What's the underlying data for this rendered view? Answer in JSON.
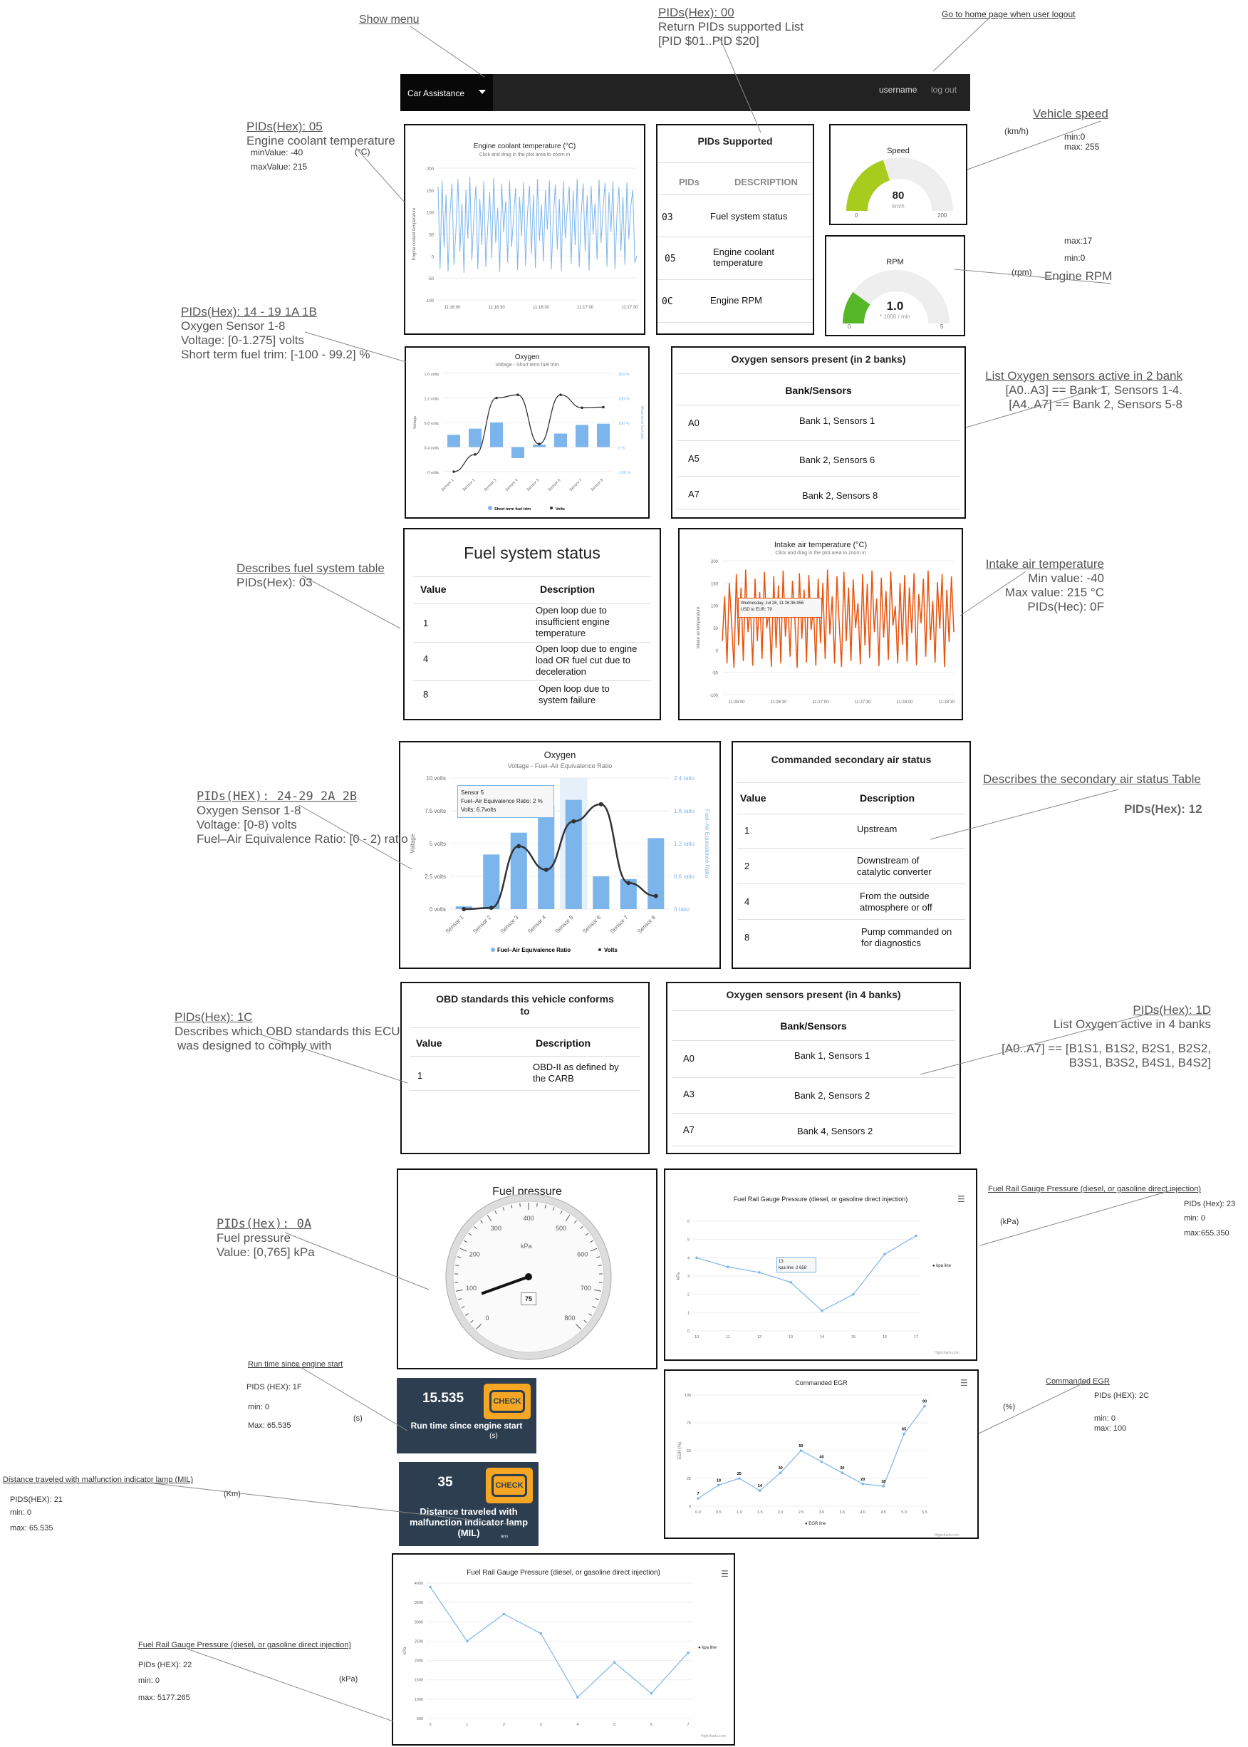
{
  "navbar": {
    "brand": "Car Assistance",
    "username": "username",
    "logout": "log out"
  },
  "top_annotations": {
    "show_menu": "Show menu",
    "pid00_title": "PIDs(Hex): 00",
    "pid00_line1": "Return PIDs supported List",
    "pid00_line2": "[PID $01..PID $20]",
    "home": "Go to home page when user logout"
  },
  "coolant": {
    "ann_pid": "PIDs(Hex): 05",
    "ann_name": "Engine coolant temperature",
    "ann_unit": "(°C)",
    "ann_min": "minValue: -40",
    "ann_max": "maxValue: 215",
    "title": "Engine coolant temperature (°C)",
    "subtitle": "Click and drag in the plot area to zoom in",
    "ylabel": "Engine coolant temperature",
    "yticks": [
      "200",
      "150",
      "100",
      "50",
      "0",
      "-50",
      "-100"
    ],
    "xticks": [
      "11:16:00",
      "11:16:30",
      "11:16:30",
      "11:17:00",
      "11:17:30"
    ]
  },
  "pids_supported": {
    "title": "PIDs Supported",
    "col_pid": "PIDs",
    "col_desc": "DESCRIPTION",
    "rows": [
      {
        "pid": "03",
        "desc": "Fuel system status"
      },
      {
        "pid": "05",
        "desc": "Engine coolant temperature"
      },
      {
        "pid": "0C",
        "desc": "Engine RPM"
      }
    ]
  },
  "speed": {
    "ann_title": "Vehicle speed",
    "ann_unit": "(km/h)",
    "ann_min": "min:0",
    "ann_max": "max: 255",
    "title": "Speed",
    "value": "80",
    "unit": "km/h",
    "min_label": "0",
    "max_label": "200",
    "fraction": 0.4
  },
  "rpm": {
    "ann_title": "Engine RPM",
    "ann_unit": "(rpm)",
    "ann_max": "max:17",
    "ann_min": "min:0",
    "title": "RPM",
    "value": "1.0",
    "unit": "* 1000 / min",
    "min_label": "0",
    "max_label": "5",
    "fraction": 0.2
  },
  "oxygen1": {
    "ann_pid": "PIDs(Hex): 14 - 19 1A 1B",
    "ann_l1": "Oxygen Sensor 1-8",
    "ann_l2": "Voltage: [0-1.275] volts",
    "ann_l3": "Short term fuel trim: [-100 - 99.2] %",
    "title": "Oxygen",
    "subtitle": "Voltage - Short term fuel trim",
    "ylabel": "Voltage",
    "y2label": "Short term fuel trim",
    "yticks": [
      "1.6 volts",
      "1.2 volts",
      "0.8 volts",
      "0.4 volts",
      "0 volts"
    ],
    "y2ticks": [
      "300 %",
      "200 %",
      "100 %",
      "0 %",
      "-100 %"
    ],
    "legend_bar": "Short term fuel trim",
    "legend_line": "Volts"
  },
  "o2_2banks": {
    "ann_l1": "List Oxygen sensors active in 2 bank",
    "ann_l2": "[A0..A3] == Bank 1, Sensors 1-4.",
    "ann_l3": "[A4..A7] == Bank 2, Sensors 5-8",
    "title": "Oxygen sensors present (in 2 banks)",
    "col": "Bank/Sensors",
    "rows": [
      {
        "code": "A0",
        "desc": "Bank 1, Sensors 1"
      },
      {
        "code": "A5",
        "desc": "Bank 2, Sensors 6"
      },
      {
        "code": "A7",
        "desc": "Bank 2, Sensors 8"
      }
    ]
  },
  "fuel_status": {
    "ann_l1": "Describes fuel system table",
    "ann_l2": "PIDs(Hex): 03",
    "title": "Fuel system status",
    "col_value": "Value",
    "col_desc": "Description",
    "rows": [
      {
        "value": "1",
        "desc": "Open loop due to insufficient engine temperature"
      },
      {
        "value": "4",
        "desc": "Open loop due to engine load OR fuel cut due to deceleration"
      },
      {
        "value": "8",
        "desc": "Open loop due to system failure"
      }
    ]
  },
  "intake": {
    "ann_title": "Intake air temperature",
    "ann_min": "Min value: -40",
    "ann_max": "Max value: 215 °C",
    "ann_pid": "PIDs(Hec): 0F",
    "title": "Intake air temperature (°C)",
    "subtitle": "Click and drag in the plot area to zoom in",
    "ylabel": "Intake air temperature",
    "yticks": [
      "200",
      "150",
      "100",
      "50",
      "0",
      "-50",
      "-100"
    ],
    "xticks": [
      "11:26:00",
      "11:26:30",
      "11:27:00",
      "11:27:30",
      "11:28:00",
      "11:28:30"
    ],
    "tooltip_l1": "Wednesday, Jul 26, 11:26:36.956",
    "tooltip_l2": "USD to EUR: 79"
  },
  "oxygen2": {
    "ann_pid": "PIDs(HEX): 24-29 2A 2B",
    "ann_l1": "Oxygen Sensor 1-8",
    "ann_l2": "Voltage: [0-8) volts",
    "ann_l3": "Fuel–Air Equivalence Ratio: [0 - 2) ratio",
    "title": "Oxygen",
    "subtitle": "Voltage - Fuel–Air Equivalence Ratio",
    "ylabel": "Voltage",
    "y2label": "Fuel–Air Equivalence Ratio",
    "yticks": [
      "10 volts",
      "7.5 volts",
      "5 volts",
      "2.5 volts",
      "0 volts"
    ],
    "y2ticks": [
      "2.4 ratio",
      "1.8 ratio",
      "1.2 ratio",
      "0.6 ratio",
      "0 ratio"
    ],
    "tooltip_l1": "Sensor 5",
    "tooltip_l2": "Fuel–Air Equivalence Ratio: 2 %",
    "tooltip_l3": "Volts: 6.7volts",
    "legend_bar": "Fuel–Air Equivalence Ratio",
    "legend_line": "Volts"
  },
  "secondary_air": {
    "ann_l1": "Describes the secondary air status Table",
    "ann_l2": "PIDs(Hex): 12",
    "title": "Commanded secondary air status",
    "col_value": "Value",
    "col_desc": "Description",
    "rows": [
      {
        "value": "1",
        "desc": "Upstream"
      },
      {
        "value": "2",
        "desc": "Downstream of catalytic converter"
      },
      {
        "value": "4",
        "desc": "From the outside atmosphere or off"
      },
      {
        "value": "8",
        "desc": "Pump commanded on for diagnostics"
      }
    ]
  },
  "obd": {
    "ann_pid": "PIDs(Hex): 1C",
    "ann_l1": "Describes which OBD standards this ECU",
    "ann_l2": "was designed to comply with",
    "title": "OBD standards this vehicle conforms to",
    "col_value": "Value",
    "col_desc": "Description",
    "rows": [
      {
        "value": "1",
        "desc": "OBD-II as defined by the CARB"
      }
    ]
  },
  "o2_4banks": {
    "ann_pid": "PIDs(Hex): 1D",
    "ann_l1": "List Oxygen active in 4 banks",
    "ann_l2": "[A0..A7] == [B1S1, B1S2, B2S1, B2S2,",
    "ann_l3": "B3S1, B3S2, B4S1, B4S2]",
    "title": "Oxygen sensors present (in 4 banks)",
    "col": "Bank/Sensors",
    "rows": [
      {
        "code": "A0",
        "desc": "Bank 1, Sensors 1"
      },
      {
        "code": "A3",
        "desc": "Bank 2, Sensors 2"
      },
      {
        "code": "A7",
        "desc": "Bank 4, Sensors 2"
      }
    ]
  },
  "fuel_pressure": {
    "ann_pid": "PIDs(Hex): 0A",
    "ann_l1": "Fuel pressure",
    "ann_l2": "Value: [0,765] kPa",
    "title": "Fuel pressure",
    "unit": "kPa",
    "value": "75",
    "max_scale": 800,
    "value_num": 75,
    "dial_labels": [
      "0",
      "100",
      "200",
      "300",
      "400",
      "500",
      "600",
      "700",
      "800"
    ]
  },
  "rail23": {
    "ann_title": "Fuel Rail Gauge Pressure (diesel, or gasoline direct injection)",
    "ann_pid": "PIDs (Hex): 23",
    "ann_unit": "(kPa)",
    "ann_min": "min: 0",
    "ann_max": "max:655.350",
    "title": "Fuel Rail Gauge Pressure (diesel, or gasoline direct injection)",
    "legend": "kpa line",
    "tooltip_l1": "13",
    "tooltip_l2": "kpa line: 2 658",
    "credit": "Highcharts.com"
  },
  "runtime": {
    "ann_title": "Run time since engine start",
    "ann_pid": "PIDS (HEX): 1F",
    "ann_min": "min: 0",
    "ann_max": "Max: 65.535",
    "ann_unit": "(s)",
    "value": "15.535",
    "label": "Run time since engine start",
    "unit": "(s)",
    "check": "CHECK"
  },
  "egr": {
    "ann_title": "Commanded EGR",
    "ann_pid": "PIDs (HEX): 2C",
    "ann_min": "min: 0",
    "ann_max": "max: 100",
    "ann_unit": "(%)",
    "title": "Commanded EGR",
    "ylabel": "EGR (%)",
    "legend": "EGR line",
    "credit": "Highcharts.com"
  },
  "mil": {
    "ann_title": "Distance traveled with malfunction indicator lamp (MIL)",
    "ann_pid": "PIDS(HEX): 21",
    "ann_min": "min: 0",
    "ann_max": "max: 65.535",
    "ann_unit": "(Km)",
    "value": "35",
    "label": "Distance traveled with malfunction indicator lamp (MIL)",
    "unit": "(km)",
    "check": "CHECK"
  },
  "rail22": {
    "ann_title": "Fuel Rail Gauge Pressure (diesel, or gasoline direct injection)",
    "ann_pid": "PIDs (HEX): 22",
    "ann_min": "min: 0",
    "ann_max": "max: 5177.265",
    "ann_unit": "(kPa)",
    "title": "Fuel Rail Gauge Pressure (diesel, or gasoline direct injection)",
    "ylabel": "kPa",
    "legend": "kpa line",
    "credit": "Highcharts.com"
  },
  "chart_data": [
    {
      "type": "line",
      "title": "Engine coolant temperature (°C)",
      "ylabel": "Engine coolant temperature",
      "ylim": [
        -100,
        200
      ],
      "x": [
        "11:16:00",
        "11:16:30",
        "11:16:30",
        "11:17:00",
        "11:17:30"
      ],
      "series": [
        {
          "values": [
            158,
            -30,
            172,
            20,
            140,
            -35,
            95,
            165,
            -20,
            60,
            175,
            10,
            120,
            -38,
            150,
            40,
            180,
            -10,
            85,
            160,
            -30,
            130,
            25,
            170,
            -25,
            70,
            145,
            -5,
            178,
            30,
            110,
            -36,
            165,
            55,
            125,
            -15,
            172,
            20,
            90,
            155,
            -32,
            135,
            45,
            168,
            -22,
            100,
            160,
            5,
            140,
            -28,
            175,
            35,
            118,
            -12,
            150,
            60,
            172,
            -30,
            88,
            162,
            15,
            130,
            -35,
            170,
            40,
            105,
            158,
            -18,
            148,
            25,
            176,
            -26,
            95,
            165,
            10,
            138,
            -33,
            160,
            50,
            120,
            -8,
            174,
            30,
            110,
            166,
            -24,
            145,
            55,
            170,
            -30,
            92,
            158,
            12,
            135,
            -20,
            168,
            38,
            115,
            150,
            -15,
            0
          ]
        }
      ]
    },
    {
      "type": "bar",
      "title": "Oxygen",
      "categories": [
        "Sensor 1",
        "Sensor 2",
        "Sensor 3",
        "Sensor 4",
        "Sensor 5",
        "Sensor 6",
        "Sensor 7",
        "Sensor 8"
      ],
      "series": [
        {
          "name": "Short term fuel trim",
          "type": "bar",
          "values": [
            50,
            75,
            100,
            -45,
            10,
            55,
            90,
            95
          ]
        },
        {
          "name": "Volts",
          "type": "line",
          "values": [
            0.0,
            0.28,
            1.2,
            1.25,
            0.45,
            1.25,
            1.04,
            1.05
          ]
        }
      ],
      "ylim": [
        0,
        1.6
      ],
      "y2lim": [
        -100,
        300
      ]
    },
    {
      "type": "line",
      "title": "Intake air temperature (°C)",
      "ylabel": "Intake air temperature",
      "ylim": [
        -100,
        200
      ],
      "x": [
        "11:26:00",
        "11:26:30",
        "11:27:00",
        "11:27:30",
        "11:28:00",
        "11:28:30"
      ],
      "series": [
        {
          "values": [
            20,
            120,
            -30,
            150,
            60,
            -40,
            170,
            10,
            140,
            -25,
            180,
            40,
            100,
            -35,
            160,
            20,
            130,
            -20,
            175,
            50,
            90,
            -38,
            165,
            5,
            145,
            -30,
            178,
            30,
            110,
            -15,
            155,
            70,
            -40,
            172,
            25,
            135,
            -28,
            168,
            45,
            95,
            -35,
            160,
            15,
            150,
            -20,
            180,
            35,
            120,
            -30,
            165,
            60,
            -38,
            175,
            20,
            140,
            -25,
            158,
            50,
            105,
            -32,
            170,
            10,
            148,
            -18,
            178,
            40,
            115,
            -36,
            162,
            28,
            132,
            -22,
            176,
            55,
            98,
            -30,
            150,
            12,
            168,
            -26,
            140,
            38,
            172,
            -34,
            125,
            60,
            160,
            -15,
            178,
            22,
            110,
            -28,
            152,
            48,
            170,
            -38,
            135,
            18,
            165,
            40
          ]
        }
      ]
    },
    {
      "type": "bar",
      "title": "Oxygen",
      "categories": [
        "Sensor 1",
        "Sensor 2",
        "Sensor 3",
        "Sensor 4",
        "Sensor 5",
        "Sensor 6",
        "Sensor 7",
        "Sensor 8"
      ],
      "series": [
        {
          "name": "Fuel–Air Equivalence Ratio",
          "type": "bar",
          "values": [
            0.05,
            1.0,
            1.4,
            1.9,
            2.0,
            0.6,
            0.55,
            1.3
          ]
        },
        {
          "name": "Volts",
          "type": "line",
          "values": [
            0.0,
            0.1,
            4.8,
            3.0,
            6.7,
            8.0,
            2.0,
            1.0
          ]
        }
      ],
      "ylim": [
        0,
        10
      ],
      "y2lim": [
        0,
        2.4
      ]
    },
    {
      "type": "line",
      "title": "Fuel Rail Gauge Pressure (diesel, or gasoline direct injection)",
      "x": [
        10,
        11,
        12,
        13,
        14,
        15,
        16,
        17
      ],
      "ylim": [
        0,
        6
      ],
      "series": [
        {
          "name": "kpa line",
          "values": [
            4.0,
            3.5,
            3.2,
            2.658,
            1.1,
            2.0,
            4.2,
            5.2
          ]
        }
      ]
    },
    {
      "type": "line",
      "title": "Commanded EGR",
      "ylabel": "EGR (%)",
      "x": [
        "0.0",
        "0.5",
        "1.0",
        "1.5",
        "2.0",
        "2.5",
        "3.0",
        "3.5",
        "4.0",
        "4.5",
        "5.0",
        "5.5"
      ],
      "ylim": [
        0,
        100
      ],
      "series": [
        {
          "name": "EGR line",
          "values": [
            7,
            19,
            25,
            14,
            30,
            50,
            40,
            30,
            20,
            18,
            65,
            90
          ]
        }
      ]
    },
    {
      "type": "line",
      "title": "Fuel Rail Gauge Pressure (diesel, or gasoline direct injection)",
      "ylabel": "kPa",
      "x": [
        0,
        1,
        2,
        3,
        4,
        5,
        6,
        7
      ],
      "ylim": [
        500,
        4000
      ],
      "series": [
        {
          "name": "kpa line",
          "values": [
            3900,
            2500,
            3200,
            2700,
            1050,
            1950,
            1150,
            2200
          ]
        }
      ]
    }
  ],
  "colors": {
    "nav_bg": "#222222",
    "chart_blue": "#7cb5ec",
    "intake_orange": "#e8530e",
    "speed_green": "#a8cc1e",
    "rpm_green": "#55b728",
    "tile_bg": "#2c3e50",
    "check_bg": "#f5a623"
  }
}
